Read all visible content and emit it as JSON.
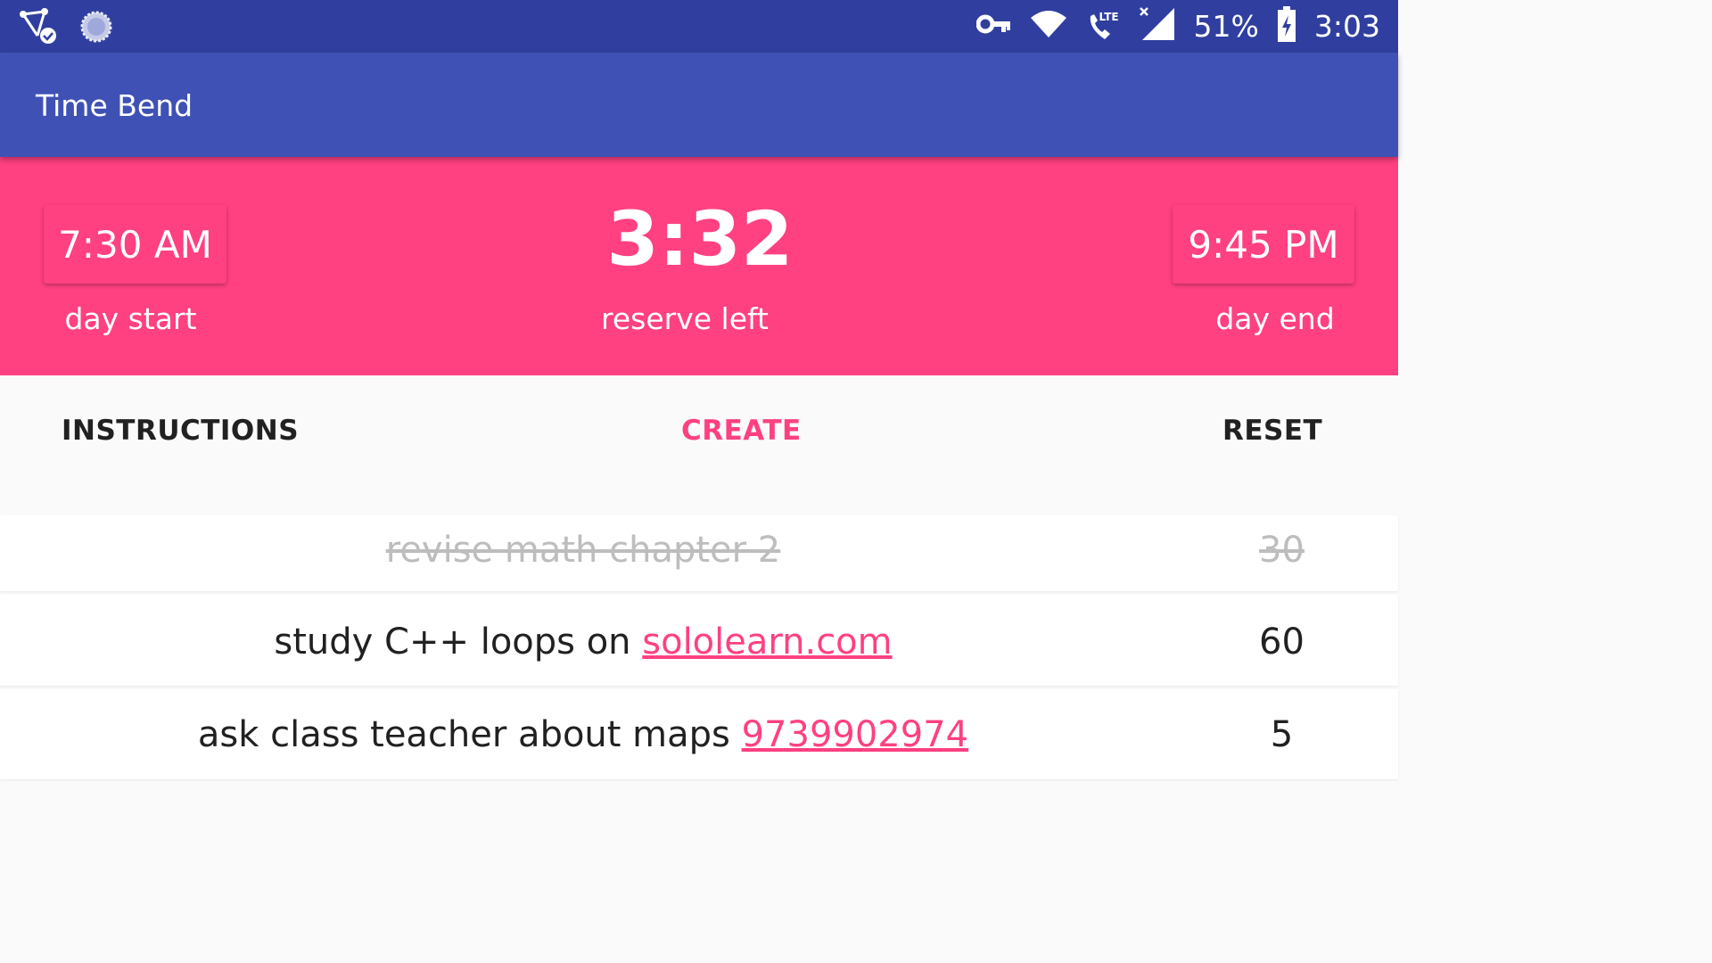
{
  "status_bar": {
    "battery": "51%",
    "time": "3:03",
    "network_badge": "LTE",
    "icons": [
      "share-check-icon",
      "loading-spinner-icon",
      "vpn-key-icon",
      "wifi-icon",
      "call-lte-icon",
      "signal-no-data-icon",
      "battery-charging-icon"
    ]
  },
  "app_bar": {
    "title": "Time Bend"
  },
  "header": {
    "day_start": {
      "time": "7:30 AM",
      "label": "day start"
    },
    "reserve": {
      "value": "3:32",
      "label": "reserve left"
    },
    "day_end": {
      "time": "9:45 PM",
      "label": "day end"
    }
  },
  "actions": {
    "instructions": "INSTRUCTIONS",
    "create": "CREATE",
    "reset": "RESET"
  },
  "tasks": [
    {
      "text": "revise math chapter 2",
      "link": "",
      "minutes": "30",
      "done": true
    },
    {
      "text": "study C++ loops on",
      "link": "sololearn.com",
      "minutes": "60",
      "done": false
    },
    {
      "text": "ask class teacher about maps",
      "link": "9739902974",
      "minutes": "5",
      "done": false
    }
  ],
  "colors": {
    "status_bar": "#303f9f",
    "app_bar": "#3f51b5",
    "accent": "#ff4081",
    "background": "#fafafa"
  }
}
